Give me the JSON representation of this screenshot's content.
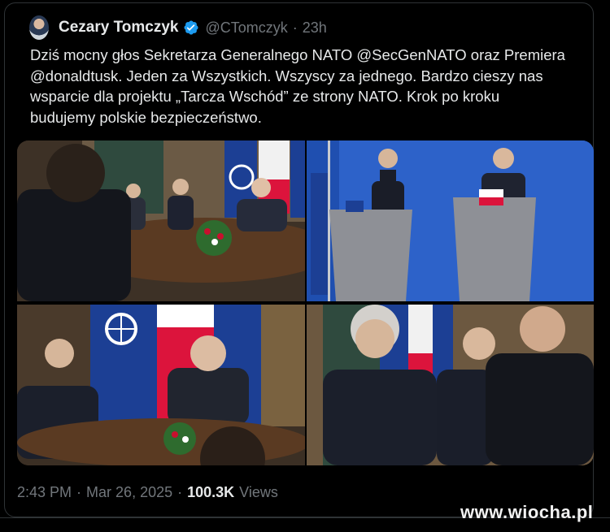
{
  "author": {
    "name": "Cezary Tomczyk",
    "handle": "@CTomczyk",
    "time_ago": "23h",
    "separator": "·"
  },
  "tweet": {
    "line1": "Dziś mocny głos Sekretarza Generalnego NATO @SecGenNATO oraz Premiera",
    "line2": "@donaldtusk. Jeden za Wszystkich. Wszyscy za jednego. Bardzo cieszy nas",
    "line3": "wsparcie dla projektu „Tarcza Wschód” ze strony NATO. Krok po kroku",
    "line4": "budujemy polskie bezpieczeństwo."
  },
  "footer": {
    "time": "2:43 PM",
    "date": "Mar 26, 2025",
    "separator": "·",
    "views_count": "100.3K",
    "views_label": "Views"
  },
  "watermark": "www.wiocha.pl",
  "colors": {
    "background": "#000000",
    "text": "#e7e9ea",
    "muted": "#71767b",
    "verified": "#1d9bf0",
    "nato_blue": "#1c3f94",
    "poland_red": "#dc143c"
  },
  "icons": [
    "verified-badge-icon",
    "avatar"
  ]
}
